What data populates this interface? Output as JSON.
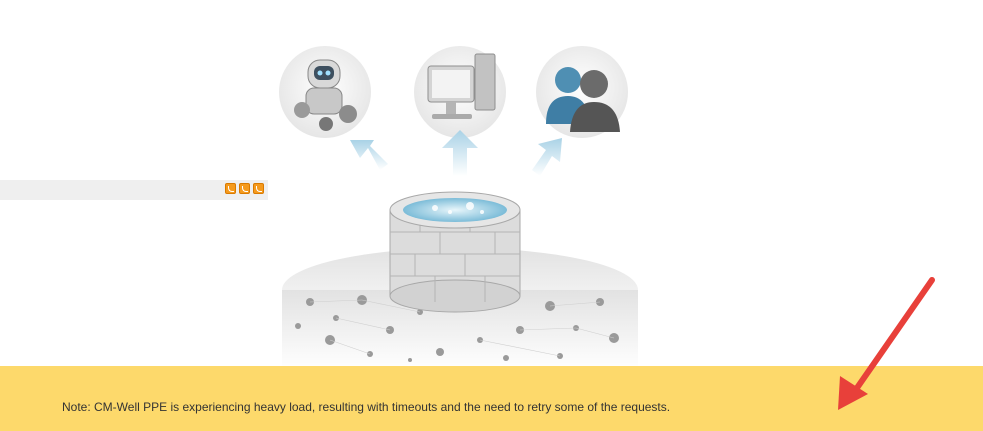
{
  "toolbar": {
    "feed_icons": [
      "rss-feed-icon",
      "rdf-feed-icon",
      "json-feed-icon"
    ]
  },
  "illustration": {
    "icons": [
      "robot-icon",
      "computer-icon",
      "users-icon",
      "data-well-icon"
    ]
  },
  "notice": {
    "text": "Note: CM-Well PPE is experiencing heavy load, resulting with timeouts and the need to retry some of the requests."
  },
  "colors": {
    "notice_background": "#fdd96b",
    "arrow": "#e8403a",
    "feed_icon": "#f59a1d"
  }
}
